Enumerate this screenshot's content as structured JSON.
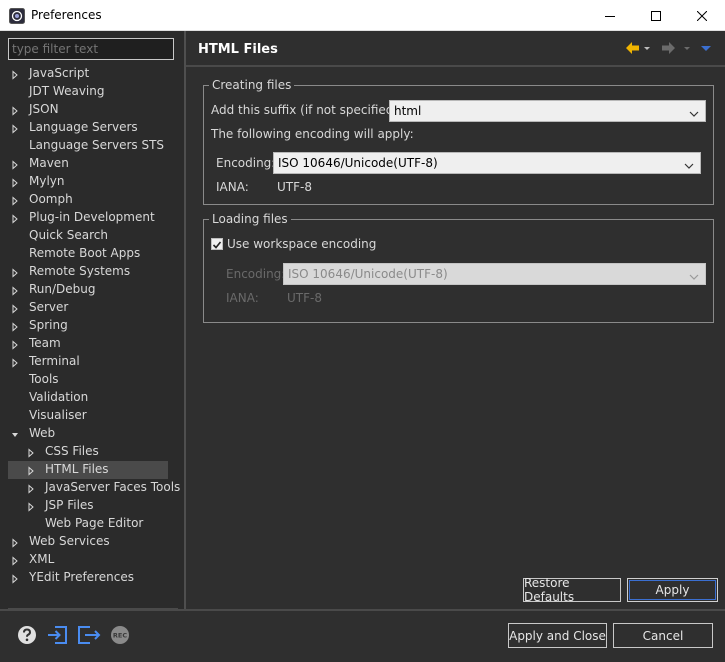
{
  "window": {
    "title": "Preferences",
    "icons": [
      "eclipse-app-icon",
      "minimize-icon",
      "maximize-icon",
      "close-icon"
    ]
  },
  "filter": {
    "placeholder": "type filter text",
    "value": ""
  },
  "tree": [
    {
      "label": "JavaScript",
      "expandable": true,
      "level": 0
    },
    {
      "label": "JDT Weaving",
      "expandable": false,
      "level": 0
    },
    {
      "label": "JSON",
      "expandable": true,
      "level": 0
    },
    {
      "label": "Language Servers",
      "expandable": true,
      "level": 0
    },
    {
      "label": "Language Servers STS",
      "expandable": false,
      "level": 0
    },
    {
      "label": "Maven",
      "expandable": true,
      "level": 0
    },
    {
      "label": "Mylyn",
      "expandable": true,
      "level": 0
    },
    {
      "label": "Oomph",
      "expandable": true,
      "level": 0
    },
    {
      "label": "Plug-in Development",
      "expandable": true,
      "level": 0
    },
    {
      "label": "Quick Search",
      "expandable": false,
      "level": 0
    },
    {
      "label": "Remote Boot Apps",
      "expandable": false,
      "level": 0
    },
    {
      "label": "Remote Systems",
      "expandable": true,
      "level": 0
    },
    {
      "label": "Run/Debug",
      "expandable": true,
      "level": 0
    },
    {
      "label": "Server",
      "expandable": true,
      "level": 0
    },
    {
      "label": "Spring",
      "expandable": true,
      "level": 0
    },
    {
      "label": "Team",
      "expandable": true,
      "level": 0
    },
    {
      "label": "Terminal",
      "expandable": true,
      "level": 0
    },
    {
      "label": "Tools",
      "expandable": false,
      "level": 0
    },
    {
      "label": "Validation",
      "expandable": false,
      "level": 0
    },
    {
      "label": "Visualiser",
      "expandable": false,
      "level": 0
    },
    {
      "label": "Web",
      "expandable": true,
      "expanded": true,
      "level": 0
    },
    {
      "label": "CSS Files",
      "expandable": true,
      "level": 1
    },
    {
      "label": "HTML Files",
      "expandable": true,
      "level": 1,
      "selected": true
    },
    {
      "label": "JavaServer Faces Tools",
      "expandable": true,
      "level": 1
    },
    {
      "label": "JSP Files",
      "expandable": true,
      "level": 1
    },
    {
      "label": "Web Page Editor",
      "expandable": false,
      "level": 1
    },
    {
      "label": "Web Services",
      "expandable": true,
      "level": 0
    },
    {
      "label": "XML",
      "expandable": true,
      "level": 0
    },
    {
      "label": "YEdit Preferences",
      "expandable": true,
      "level": 0
    }
  ],
  "page": {
    "title": "HTML Files",
    "nav_icons": [
      "back-arrow-icon",
      "back-dropdown-icon",
      "forward-arrow-icon",
      "forward-dropdown-icon",
      "view-menu-icon"
    ]
  },
  "creating": {
    "legend": "Creating files",
    "suffix_label": "Add this suffix (if not specified):",
    "suffix_value": "html",
    "following": "The following encoding will apply:",
    "encoding_label": "Encoding:",
    "encoding_value": "ISO 10646/Unicode(UTF-8)",
    "iana_label": "IANA:",
    "iana_value": "UTF-8"
  },
  "loading": {
    "legend": "Loading files",
    "use_workspace_label": "Use workspace encoding",
    "use_workspace_checked": true,
    "encoding_label": "Encoding:",
    "encoding_value": "ISO 10646/Unicode(UTF-8)",
    "iana_label": "IANA:",
    "iana_value": "UTF-8"
  },
  "buttons": {
    "restore_defaults": "Restore Defaults",
    "apply": "Apply",
    "apply_and_close": "Apply and Close",
    "cancel": "Cancel"
  },
  "footer_icons": [
    "help-icon",
    "import-icon",
    "export-icon",
    "record-icon"
  ],
  "colors": {
    "accent_yellow": "#f0b400",
    "accent_blue": "#3b6fd0",
    "footer_icon_blue": "#4a8cf0"
  }
}
